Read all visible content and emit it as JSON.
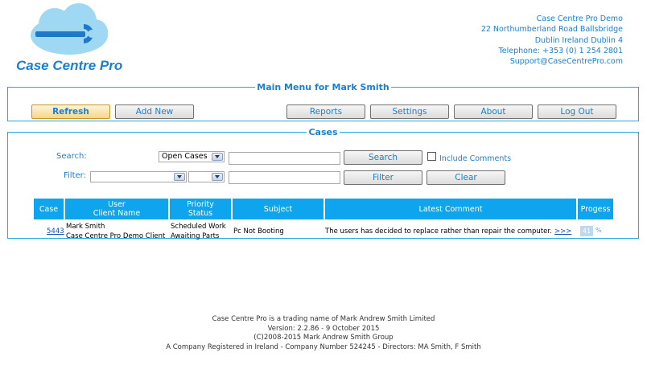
{
  "logo": {
    "text": "Case Centre Pro"
  },
  "contact": {
    "lines": [
      "Case Centre Pro Demo",
      "22 Northumberland Road Ballsbridge",
      "Dublin Ireland Dublin 4",
      "Telephone: +353 (0) 1 254 2801",
      "Support@CaseCentrePro.com"
    ]
  },
  "menu": {
    "legend": "Main Menu for Mark Smith",
    "buttons": {
      "refresh": "Refresh",
      "add_new": "Add New",
      "reports": "Reports",
      "settings": "Settings",
      "about": "About",
      "log_out": "Log Out"
    }
  },
  "cases": {
    "legend": "Cases",
    "search_label": "Search:",
    "filter_label": "Filter:",
    "search_scope": "Open Cases",
    "search_button": "Search",
    "include_comments": "Include Comments",
    "filter_button": "Filter",
    "clear_button": "Clear",
    "columns": {
      "case": "Case",
      "user": "User",
      "client_name": "Client Name",
      "priority": "Priority",
      "status": "Status",
      "subject": "Subject",
      "latest_comment": "Latest Comment",
      "progress": "Progess"
    },
    "rows": [
      {
        "case": "5443",
        "user": "Mark Smith",
        "client": "Case Centre Pro Demo Client",
        "priority": "Scheduled Work",
        "status": "Awaiting Parts",
        "subject": "Pc Not Booting",
        "comment": "The users has decided to replace rather than repair the computer.",
        "more": ">>>",
        "progress": "41",
        "progress_unit": "%"
      }
    ]
  },
  "footer": {
    "lines": [
      "Case Centre Pro is a trading name of Mark Andrew Smith Limited",
      "Version: 2.2.86 - 9 October 2015",
      "(C)2008-2015 Mark Andrew Smith Group",
      "A Company Registered in Ireland - Company Number 524245 - Directors: MA Smith, F Smith"
    ]
  },
  "colors": {
    "accent": "#1a7fd0",
    "header": "#0ea5ee",
    "border": "#29a9e0"
  }
}
